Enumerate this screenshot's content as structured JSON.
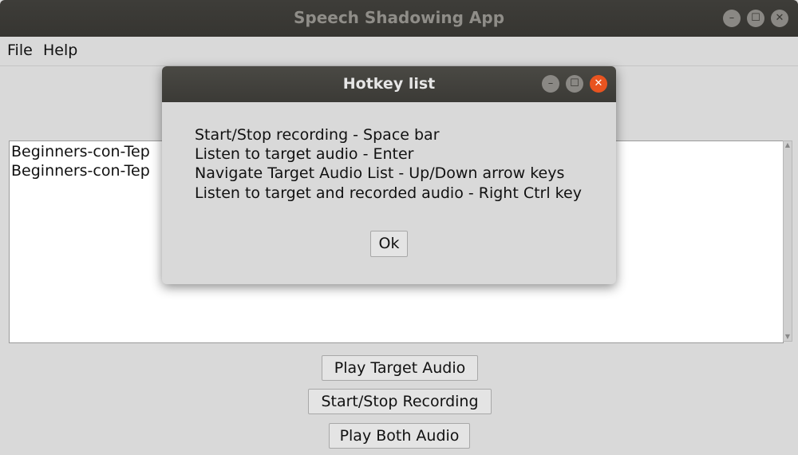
{
  "window": {
    "title": "Speech Shadowing App",
    "controls": {
      "minimize": "–",
      "maximize": "☐",
      "close": "✕"
    }
  },
  "menu": {
    "file": "File",
    "help": "Help"
  },
  "list": {
    "items": [
      "Beginners-con-Tep",
      "Beginners-con-Tep"
    ]
  },
  "buttons": {
    "play_target": "Play Target Audio",
    "start_stop": "Start/Stop Recording",
    "play_both": "Play Both Audio"
  },
  "dialog": {
    "title": "Hotkey list",
    "lines": [
      "Start/Stop recording - Space bar",
      "Listen to target audio - Enter",
      "Navigate Target Audio List - Up/Down arrow keys",
      "Listen to target and recorded audio - Right Ctrl key"
    ],
    "ok_label": "Ok",
    "controls": {
      "minimize": "–",
      "maximize": "☐",
      "close": "✕"
    }
  },
  "colors": {
    "titlebar": "#3b3a36",
    "close_accent": "#e95420",
    "window_bg": "#d9d9d9"
  },
  "icons": [
    "minimize-icon",
    "maximize-icon",
    "close-icon",
    "scroll-up-icon",
    "scroll-down-icon"
  ]
}
